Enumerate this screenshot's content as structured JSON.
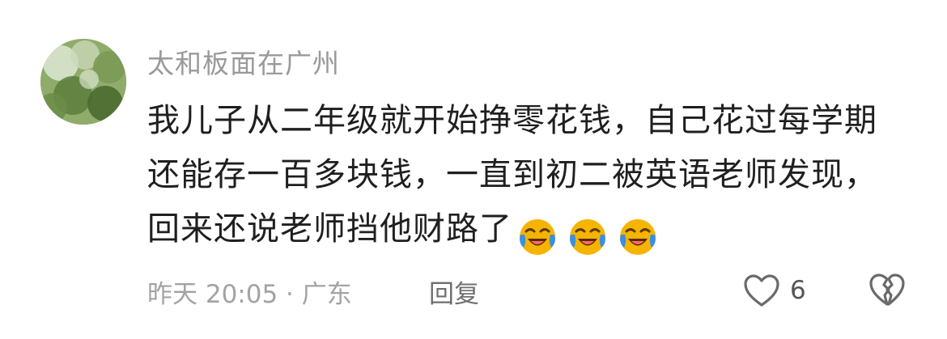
{
  "comment": {
    "username": "太和板面在广州",
    "body": "我儿子从二年级就开始挣零花钱，自己花过每学期还能存一百多块钱，一直到初二被英语老师发现，回来还说老师挡他财路了",
    "emojis": [
      "crying-laughing-emoji",
      "crying-laughing-emoji",
      "crying-laughing-emoji"
    ],
    "time_location": "昨天 20:05 · 广东",
    "reply_label": "回复",
    "like_count": "6"
  },
  "icons": {
    "like": "heart-outline-icon",
    "dislike": "broken-heart-icon"
  },
  "colors": {
    "username": "#9a9a9a",
    "body": "#1f1f1f",
    "meta": "#a3a3a3",
    "emoji_face": "#f5b400",
    "emoji_tears": "#3a8fe0"
  }
}
